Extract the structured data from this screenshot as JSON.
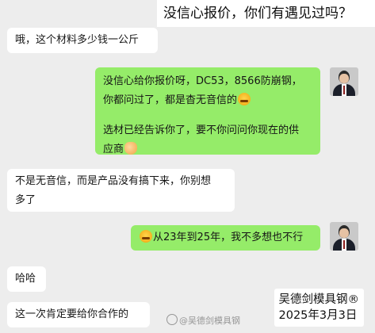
{
  "header": {
    "title": "没信心报价，你们有遇见过吗？"
  },
  "messages": [
    {
      "side": "left",
      "text": "哦，这个材料多少钱一公斤"
    },
    {
      "side": "right",
      "line1": "没信心给你报价呀，DC53，8566防崩钢，",
      "line2a": "你都问过了，都是杳无音信的",
      "emoji1": "face-emoji",
      "line3": "选材已经告诉你了，要不你问问你现在的供",
      "line4a": "应商",
      "emoji2": "handshake-emoji"
    },
    {
      "side": "left",
      "line1": "不是无音信，而是产品没有搞下来，你别想",
      "line2": "多了"
    },
    {
      "side": "right",
      "emoji": "face-emoji",
      "text": "从23年到25年，我不多想也不行"
    },
    {
      "side": "left",
      "text": "哈哈"
    },
    {
      "side": "left",
      "text": "这一次肯定要给你合作的"
    }
  ],
  "watermark": {
    "line1": "吴德剑模具钢®",
    "line2": "2025年3月3日",
    "source": "@吴德剑模具钢"
  }
}
